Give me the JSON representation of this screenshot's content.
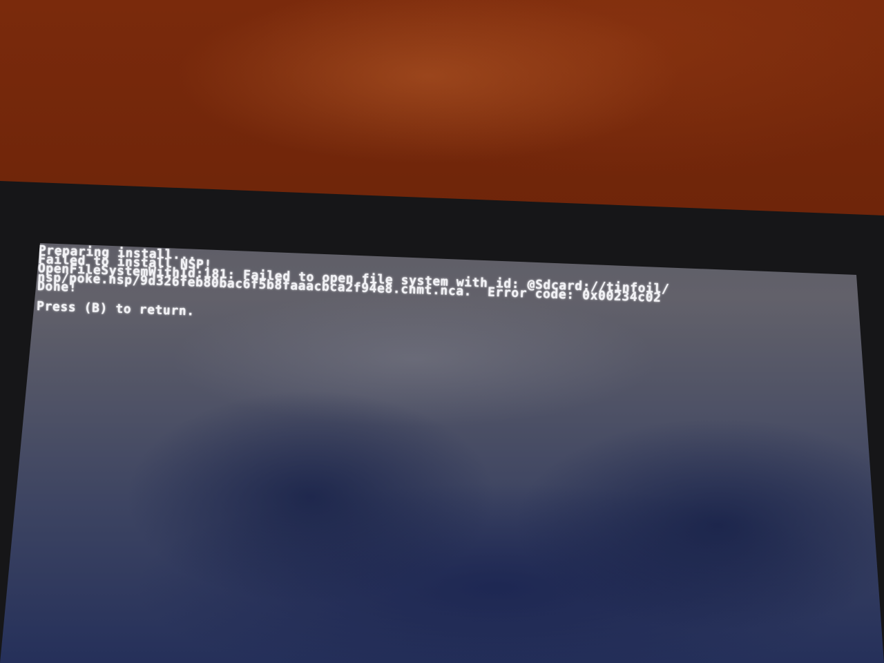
{
  "terminal": {
    "lines": [
      "Preparing install...",
      "Failed to install NSP!",
      "OpenFileSystemWithId:181: Failed to open file system with id: @Sdcard://tinfoil/",
      "nsp/poke.nsp/9d326feb80bac6f5b8faaacbca2f94e8.cnmt.nca.  Error code: 0x00234c02",
      "Done!"
    ],
    "prompt": "Press (B) to return."
  }
}
